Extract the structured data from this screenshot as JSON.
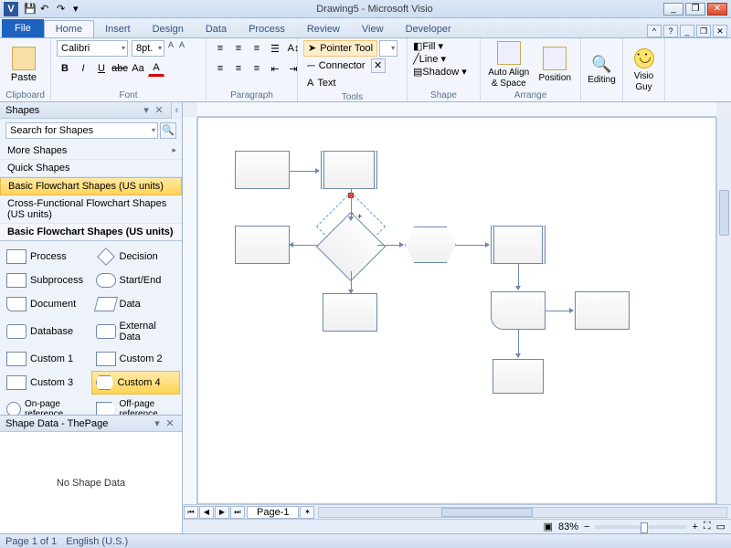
{
  "app": {
    "title": "Drawing5 - Microsoft Visio",
    "icon_letter": "V"
  },
  "win": {
    "minimize": "_",
    "restore": "❐",
    "close": "✕",
    "help": "?"
  },
  "tabs": {
    "file": "File",
    "home": "Home",
    "insert": "Insert",
    "design": "Design",
    "data": "Data",
    "process": "Process",
    "review": "Review",
    "view": "View",
    "developer": "Developer"
  },
  "ribbon": {
    "clipboard": {
      "label": "Clipboard",
      "paste": "Paste"
    },
    "font": {
      "label": "Font",
      "family": "Calibri",
      "size": "8pt.",
      "bold": "B",
      "italic": "I",
      "underline": "U",
      "strike": "abc",
      "caps": "Aa",
      "grow": "A",
      "shrink": "A"
    },
    "paragraph": {
      "label": "Paragraph"
    },
    "tools": {
      "label": "Tools",
      "pointer": "Pointer Tool",
      "connector": "Connector",
      "text": "Text",
      "close": "✕"
    },
    "shape": {
      "label": "Shape",
      "fill": "Fill",
      "line": "Line",
      "shadow": "Shadow"
    },
    "arrange": {
      "label": "Arrange",
      "autoalign": "Auto Align & Space",
      "position": "Position"
    },
    "editing": {
      "label": "Editing"
    },
    "visioguy": {
      "label": "Visio Guy"
    }
  },
  "shapes_pane": {
    "title": "Shapes",
    "search_placeholder": "Search for Shapes",
    "more": "More Shapes",
    "quick": "Quick Shapes",
    "basic": "Basic Flowchart Shapes (US units)",
    "cross": "Cross-Functional Flowchart Shapes (US units)",
    "stencil_title": "Basic Flowchart Shapes (US units)",
    "items": {
      "process": "Process",
      "decision": "Decision",
      "subprocess": "Subprocess",
      "startend": "Start/End",
      "document": "Document",
      "data": "Data",
      "database": "Database",
      "extdata": "External Data",
      "custom1": "Custom 1",
      "custom2": "Custom 2",
      "custom3": "Custom 3",
      "custom4": "Custom 4",
      "onpage": "On-page reference",
      "offpage": "Off-page reference"
    }
  },
  "shapedata": {
    "title": "Shape Data - ThePage",
    "empty": "No Shape Data"
  },
  "pagetabs": {
    "page1": "Page-1"
  },
  "status": {
    "page": "Page 1 of 1",
    "lang": "English (U.S.)",
    "zoom": "83%"
  },
  "zoom": {
    "minus": "−",
    "plus": "+"
  }
}
